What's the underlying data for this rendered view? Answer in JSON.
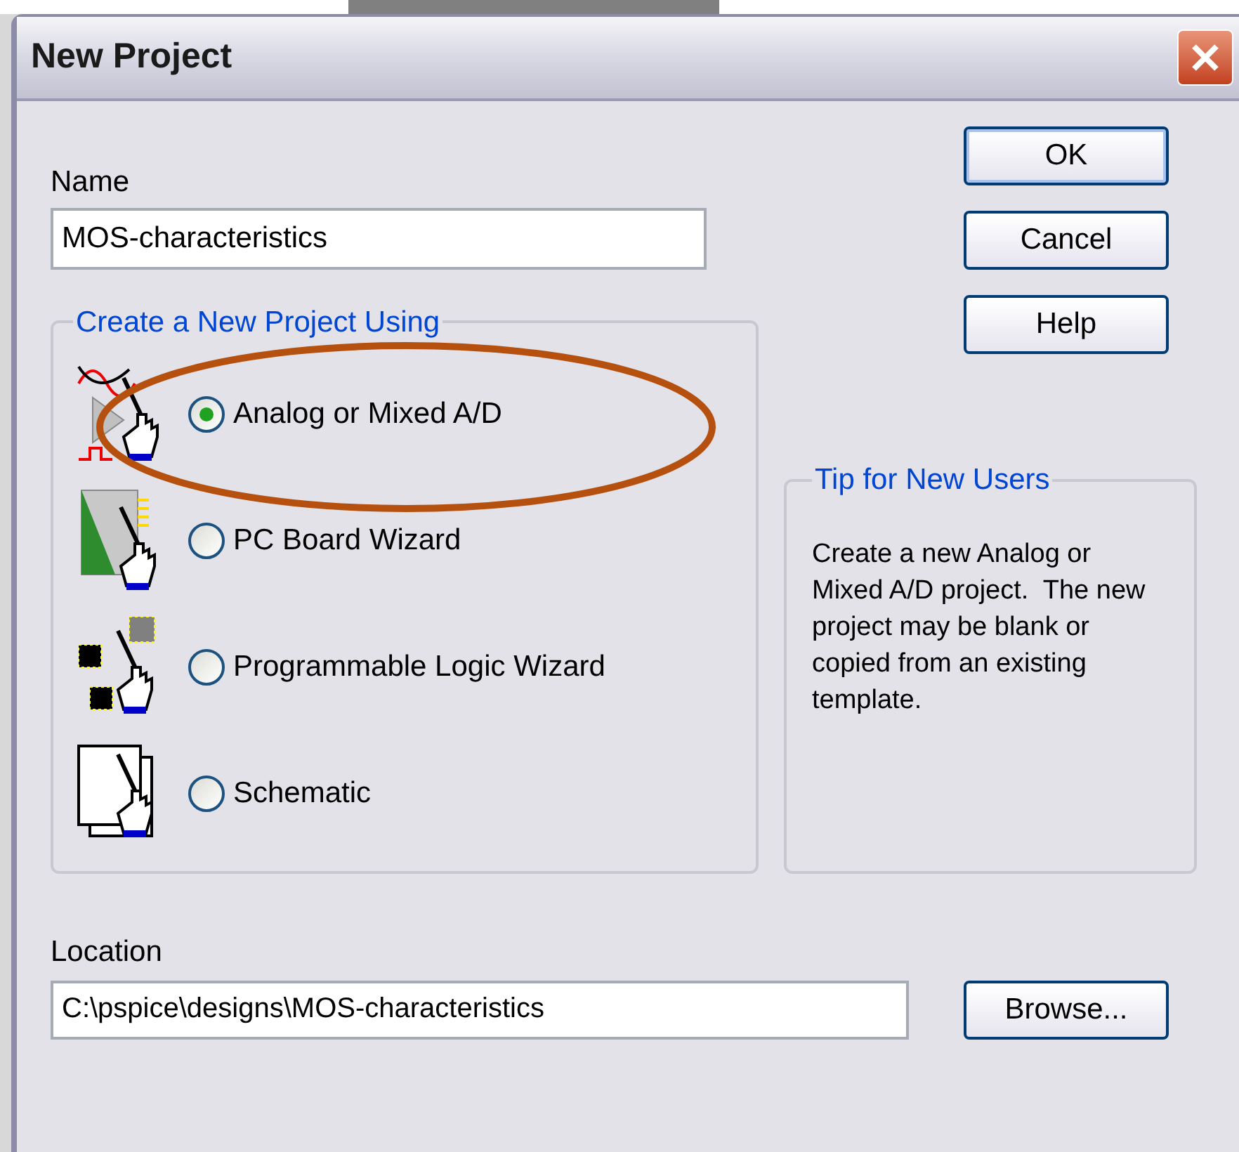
{
  "window": {
    "title": "New Project"
  },
  "name_field": {
    "label": "Name",
    "value": "MOS-characteristics"
  },
  "buttons": [
    {
      "label": "OK",
      "kind": "default"
    },
    {
      "label": "Cancel",
      "kind": "normal"
    },
    {
      "label": "Help",
      "kind": "normal"
    }
  ],
  "project_type": {
    "title": "Create a New Project Using",
    "options": [
      {
        "label": "Analog or Mixed A/D",
        "selected": true,
        "kind": "analog"
      },
      {
        "label": "PC Board Wizard",
        "selected": false,
        "kind": "board"
      },
      {
        "label": "Programmable Logic Wizard",
        "selected": false,
        "kind": "logic"
      },
      {
        "label": "Schematic",
        "selected": false,
        "kind": "schematic"
      }
    ]
  },
  "tip": {
    "title": "Tip for New Users",
    "text": "Create a new Analog or Mixed A/D project.  The new project may be blank or copied from an existing template."
  },
  "location_field": {
    "label": "Location",
    "value": "C:\\pspice\\designs\\MOS-characteristics"
  },
  "browse_button": {
    "label": "Browse..."
  },
  "annotation": {
    "kind": "ellipse"
  }
}
